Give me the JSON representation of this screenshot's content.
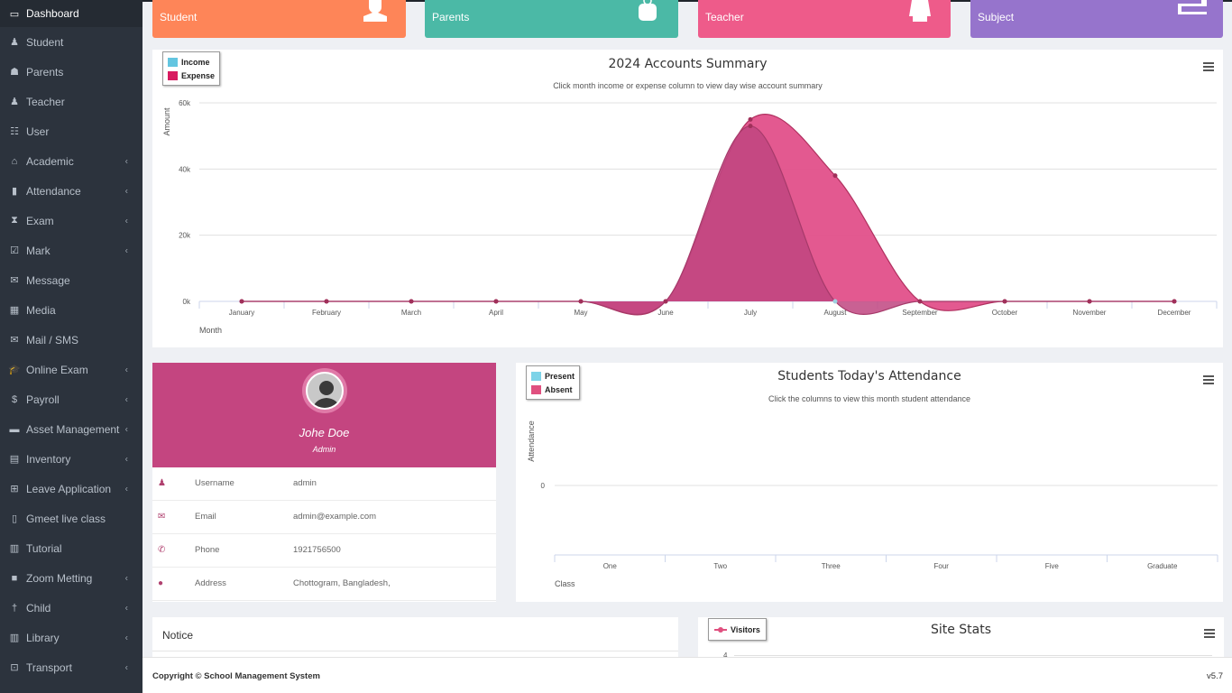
{
  "sidebar": {
    "items": [
      {
        "label": "Dashboard",
        "icon": "laptop-icon",
        "glyph": "▭",
        "active": true,
        "submenu": false
      },
      {
        "label": "Student",
        "icon": "student-icon",
        "glyph": "♟",
        "submenu": false
      },
      {
        "label": "Parents",
        "icon": "parents-icon",
        "glyph": "☗",
        "submenu": false
      },
      {
        "label": "Teacher",
        "icon": "teacher-icon",
        "glyph": "♟",
        "submenu": false
      },
      {
        "label": "User",
        "icon": "users-icon",
        "glyph": "☷",
        "submenu": false
      },
      {
        "label": "Academic",
        "icon": "academic-icon",
        "glyph": "⌂",
        "submenu": true
      },
      {
        "label": "Attendance",
        "icon": "clipboard-icon",
        "glyph": "▮",
        "submenu": true
      },
      {
        "label": "Exam",
        "icon": "hourglass-icon",
        "glyph": "⧗",
        "submenu": true
      },
      {
        "label": "Mark",
        "icon": "check-square-icon",
        "glyph": "☑",
        "submenu": true
      },
      {
        "label": "Message",
        "icon": "envelope-icon",
        "glyph": "✉",
        "submenu": false
      },
      {
        "label": "Media",
        "icon": "film-icon",
        "glyph": "▦",
        "submenu": false
      },
      {
        "label": "Mail / SMS",
        "icon": "mail-open-icon",
        "glyph": "✉",
        "submenu": false
      },
      {
        "label": "Online Exam",
        "icon": "graduation-cap-icon",
        "glyph": "🎓",
        "submenu": true
      },
      {
        "label": "Payroll",
        "icon": "dollar-icon",
        "glyph": "$",
        "submenu": true
      },
      {
        "label": "Asset Management",
        "icon": "archive-icon",
        "glyph": "▬",
        "submenu": true
      },
      {
        "label": "Inventory",
        "icon": "fax-icon",
        "glyph": "▤",
        "submenu": true
      },
      {
        "label": "Leave Application",
        "icon": "leave-icon",
        "glyph": "⊞",
        "submenu": true
      },
      {
        "label": "Gmeet live class",
        "icon": "file-video-icon",
        "glyph": "▯",
        "submenu": false
      },
      {
        "label": "Tutorial",
        "icon": "book-icon",
        "glyph": "▥",
        "submenu": false
      },
      {
        "label": "Zoom Metting",
        "icon": "video-camera-icon",
        "glyph": "■",
        "submenu": true
      },
      {
        "label": "Child",
        "icon": "child-icon",
        "glyph": "†",
        "submenu": true
      },
      {
        "label": "Library",
        "icon": "library-icon",
        "glyph": "▥",
        "submenu": true
      },
      {
        "label": "Transport",
        "icon": "bus-icon",
        "glyph": "⊡",
        "submenu": true
      }
    ],
    "caret_glyph": "‹"
  },
  "stat_cards": [
    {
      "label": "Student",
      "icon": "student-icon",
      "color": "#fe8558"
    },
    {
      "label": "Parents",
      "icon": "parents-icon",
      "color": "#4bb9a6"
    },
    {
      "label": "Teacher",
      "icon": "teacher-icon",
      "color": "#ee5b8a"
    },
    {
      "label": "Subject",
      "icon": "book-icon",
      "color": "#9674cc"
    }
  ],
  "accounts_chart": {
    "chart_data": {
      "type": "area",
      "title": "2024 Accounts Summary",
      "subtitle": "Click month income or expense column to view day wise account summary",
      "xlabel": "Month",
      "ylabel": "Amount",
      "categories": [
        "January",
        "February",
        "March",
        "April",
        "May",
        "June",
        "July",
        "August",
        "September",
        "October",
        "November",
        "December"
      ],
      "yticks": [
        "0k",
        "20k",
        "40k",
        "60k"
      ],
      "ylim": [
        0,
        60000
      ],
      "grid": true,
      "legend_position": "top-left",
      "series": [
        {
          "name": "Income",
          "color": "#63c5e0",
          "fill": "#c0457f",
          "values": [
            0,
            0,
            0,
            0,
            0,
            0,
            53000,
            0,
            0,
            0,
            0,
            0
          ]
        },
        {
          "name": "Expense",
          "color": "#d81b60",
          "fill": "#e0427f",
          "values": [
            0,
            0,
            0,
            0,
            0,
            0,
            55000,
            38000,
            0,
            0,
            0,
            0
          ]
        }
      ]
    }
  },
  "profile": {
    "name": "Johe Doe",
    "role": "Admin",
    "rows": [
      {
        "icon": "user-icon",
        "glyph": "♟",
        "label": "Username",
        "value": "admin"
      },
      {
        "icon": "envelope-icon",
        "glyph": "✉",
        "label": "Email",
        "value": "admin@example.com"
      },
      {
        "icon": "phone-icon",
        "glyph": "✆",
        "label": "Phone",
        "value": "1921756500"
      },
      {
        "icon": "globe-icon",
        "glyph": "●",
        "label": "Address",
        "value": "Chottogram, Bangladesh,"
      }
    ]
  },
  "attendance_chart": {
    "chart_data": {
      "type": "bar",
      "title": "Students Today's Attendance",
      "subtitle": "Click the columns to view this month student attendance",
      "xlabel": "Class",
      "ylabel": "Attendance",
      "categories": [
        "One",
        "Two",
        "Three",
        "Four",
        "Five",
        "Graduate"
      ],
      "yticks": [
        "0"
      ],
      "legend_position": "top-left",
      "series": [
        {
          "name": "Present",
          "color": "#7dd3e8",
          "values": [
            0,
            0,
            0,
            0,
            0,
            0
          ]
        },
        {
          "name": "Absent",
          "color": "#e0507f",
          "values": [
            0,
            0,
            0,
            0,
            0,
            0
          ]
        }
      ]
    }
  },
  "notice": {
    "title": "Notice"
  },
  "site_stats": {
    "chart_data": {
      "type": "line",
      "title": "Site Stats",
      "legend": [
        "Visitors"
      ],
      "legend_color": "#e0507f",
      "yticks_visible": [
        "4"
      ]
    }
  },
  "footer": {
    "copyright": "Copyright © School Management System",
    "version": "v5.7"
  }
}
